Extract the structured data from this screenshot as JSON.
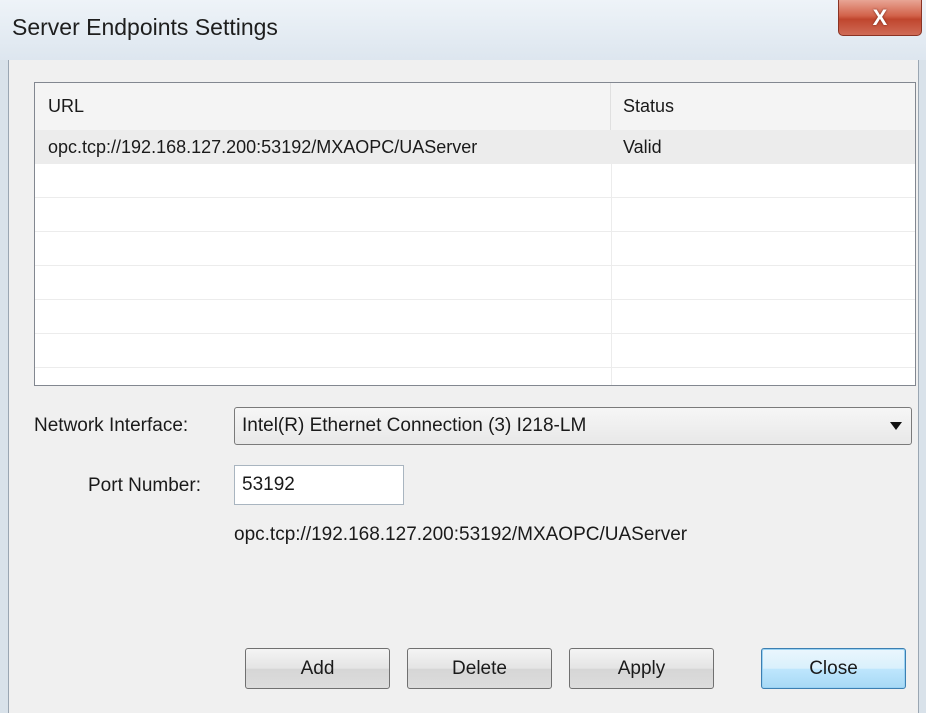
{
  "window": {
    "title": "Server Endpoints Settings",
    "close_glyph": "X"
  },
  "endpoints": {
    "columns": [
      "URL",
      "Status"
    ],
    "rows": [
      {
        "url": "opc.tcp://192.168.127.200:53192/MXAOPC/UAServer",
        "status": "Valid"
      }
    ]
  },
  "form": {
    "network_interface_label": "Network Interface:",
    "network_interface_value": "Intel(R) Ethernet Connection (3) I218-LM",
    "port_label": "Port Number:",
    "port_value": "53192",
    "url_preview": "opc.tcp://192.168.127.200:53192/MXAOPC/UAServer"
  },
  "buttons": {
    "add": "Add",
    "delete": "Delete",
    "apply": "Apply",
    "close": "Close"
  },
  "icons": {
    "close": "close-icon",
    "dropdown": "chevron-down-icon"
  }
}
